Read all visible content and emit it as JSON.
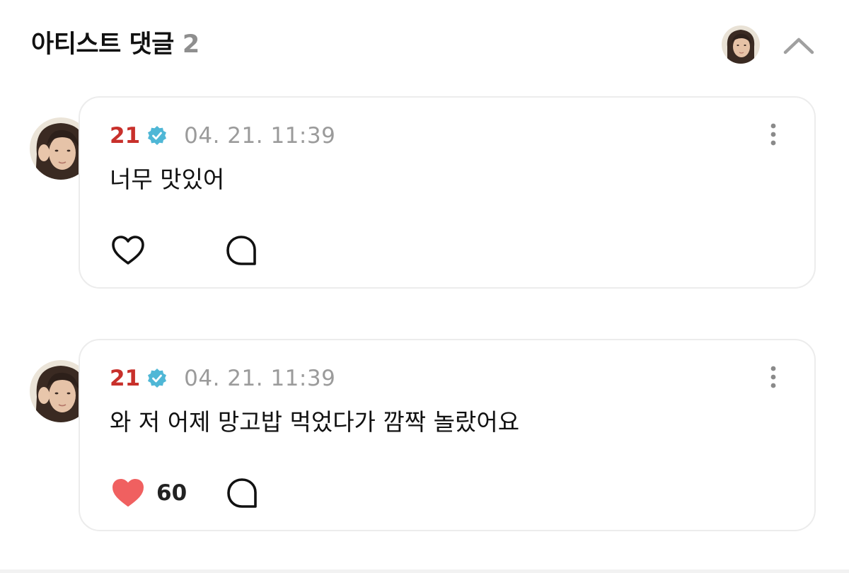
{
  "header": {
    "title": "아티스트 댓글",
    "count": "2",
    "avatar_icon": "profile-avatar",
    "collapse_icon": "chevron-up-icon"
  },
  "comments": [
    {
      "author": "21",
      "verified_icon": "verified-badge-icon",
      "timestamp": "04. 21. 11:39",
      "text": "너무 맛있어",
      "liked": false,
      "like_count": ""
    },
    {
      "author": "21",
      "verified_icon": "verified-badge-icon",
      "timestamp": "04. 21. 11:39",
      "text": "와 저 어제 망고밥 먹었다가 깜짝 놀랐어요",
      "liked": true,
      "like_count": "60"
    }
  ],
  "colors": {
    "author_name": "#c8302b",
    "verified_badge": "#4fb7d6",
    "like_filled": "#f06060",
    "timestamp": "#9b9b9b",
    "count": "#8e8e8e"
  }
}
